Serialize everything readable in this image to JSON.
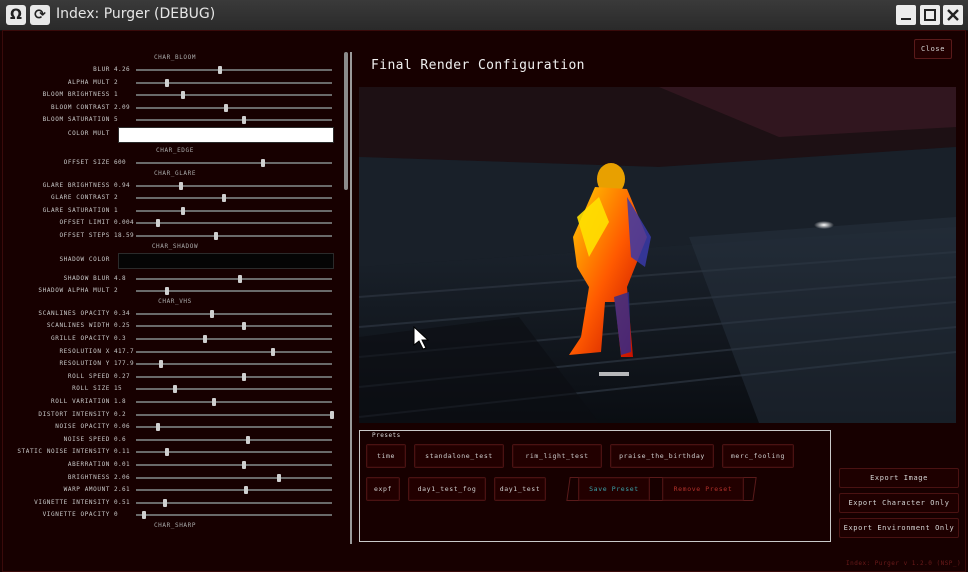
{
  "window": {
    "title": "Index: Purger (DEBUG)",
    "app_icon": "omega-icon",
    "second_icon": "refresh-icon"
  },
  "left_panel": {
    "sections": [
      {
        "title": "CHAR_BLOOM",
        "rows": [
          {
            "label": "BLUR",
            "value": "4.26",
            "fill": 0.43
          },
          {
            "label": "ALPHA MULT",
            "value": "2",
            "fill": 0.16
          },
          {
            "label": "BLOOM BRIGHTNESS",
            "value": "1",
            "fill": 0.24
          },
          {
            "label": "BLOOM CONTRAST",
            "value": "2.09",
            "fill": 0.46
          },
          {
            "label": "BLOOM SATURATION",
            "value": "5",
            "fill": 0.55
          }
        ]
      },
      {
        "title": "",
        "color_rows": [
          {
            "label": "COLOR MULT",
            "color": "#ffffff"
          }
        ]
      },
      {
        "title": "CHAR_EDGE",
        "rows": [
          {
            "label": "OFFSET SIZE",
            "value": "600",
            "fill": 0.65
          }
        ]
      },
      {
        "title": "CHAR_GLARE",
        "rows": [
          {
            "label": "GLARE BRIGHTNESS",
            "value": "0.94",
            "fill": 0.23
          },
          {
            "label": "GLARE CONTRAST",
            "value": "2",
            "fill": 0.45
          },
          {
            "label": "GLARE SATURATION",
            "value": "1",
            "fill": 0.24
          },
          {
            "label": "OFFSET LIMIT",
            "value": "0.004",
            "fill": 0.11
          },
          {
            "label": "OFFSET STEPS",
            "value": "18.59",
            "fill": 0.41
          }
        ]
      },
      {
        "title": "CHAR_SHADOW",
        "color_rows": [
          {
            "label": "SHADOW COLOR",
            "color": "#050505"
          }
        ],
        "rows": [
          {
            "label": "SHADOW BLUR",
            "value": "4.8",
            "fill": 0.53
          },
          {
            "label": "SHADOW ALPHA MULT",
            "value": "2",
            "fill": 0.16
          }
        ]
      },
      {
        "title": "CHAR_VHS",
        "rows": [
          {
            "label": "SCANLINES OPACITY",
            "value": "0.34",
            "fill": 0.39
          },
          {
            "label": "SCANLINES WIDTH",
            "value": "0.25",
            "fill": 0.55
          },
          {
            "label": "GRILLE OPACITY",
            "value": "0.3",
            "fill": 0.35
          },
          {
            "label": "RESOLUTION X",
            "value": "417.7",
            "fill": 0.7
          },
          {
            "label": "RESOLUTION Y",
            "value": "177.9",
            "fill": 0.13
          },
          {
            "label": "ROLL SPEED",
            "value": "0.27",
            "fill": 0.55
          },
          {
            "label": "ROLL SIZE",
            "value": "15",
            "fill": 0.2
          },
          {
            "label": "ROLL VARIATION",
            "value": "1.8",
            "fill": 0.4
          },
          {
            "label": "DISTORT INTENSITY",
            "value": "0.2",
            "fill": 1.0
          },
          {
            "label": "NOISE OPACITY",
            "value": "0.06",
            "fill": 0.11
          },
          {
            "label": "NOISE SPEED",
            "value": "0.6",
            "fill": 0.57
          },
          {
            "label": "STATIC NOISE INTENSITY",
            "value": "0.11",
            "fill": 0.16
          },
          {
            "label": "ABERRATION",
            "value": "0.01",
            "fill": 0.55
          },
          {
            "label": "BRIGHTNESS",
            "value": "2.06",
            "fill": 0.73
          },
          {
            "label": "WARP AMOUNT",
            "value": "2.61",
            "fill": 0.56
          },
          {
            "label": "VIGNETTE INTENSITY",
            "value": "0.51",
            "fill": 0.15
          },
          {
            "label": "VIGNETTE OPACITY",
            "value": "0",
            "fill": 0.04
          }
        ]
      },
      {
        "title": "CHAR_SHARP",
        "rows": []
      }
    ]
  },
  "right_panel": {
    "close_label": "Close",
    "render_title": "Final Render Configuration",
    "presets_title": "Presets",
    "presets": [
      [
        "time",
        "standalone_test",
        "rim_light_test",
        "praise_the_birthday",
        "merc_fooling"
      ],
      [
        "expf",
        "day1_test_fog",
        "day1_test"
      ]
    ],
    "save_preset": "Save Preset",
    "remove_preset": "Remove Preset",
    "export_image": "Export Image",
    "export_character": "Export Character Only",
    "export_environment": "Export Environment Only",
    "version": "Index: Purger v 1.2.0 (NSP_)"
  },
  "colors": {
    "accent_save": "#3aa0a8",
    "accent_remove": "#b0302a",
    "panel_bg": "#170000"
  }
}
